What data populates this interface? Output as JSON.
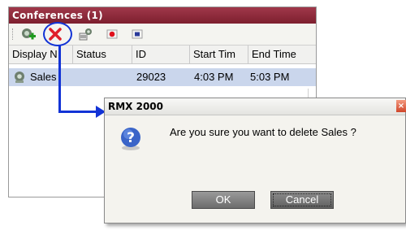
{
  "panel": {
    "title": "Conferences (1)",
    "columns": [
      "Display N",
      "Status",
      "ID",
      "Start Tim",
      "End Time"
    ],
    "rows": [
      {
        "display_name": "Sales",
        "status": "",
        "id": "29023",
        "start_time": "4:03 PM",
        "end_time": "5:03 PM"
      }
    ],
    "toolbar_icons": [
      "add-conference-icon",
      "delete-conference-icon",
      "conference-properties-icon",
      "record-icon",
      "stop-icon"
    ]
  },
  "dialog": {
    "title": "RMX 2000",
    "message": "Are you sure you want to delete Sales ?",
    "ok_label": "OK",
    "cancel_label": "Cancel",
    "icon": "question-icon"
  },
  "colors": {
    "panel_title_bg": "#8b2a3a",
    "annotation": "#1233d6",
    "row_selected": "#cad6ec",
    "button_gray": "#7a7a7a"
  }
}
